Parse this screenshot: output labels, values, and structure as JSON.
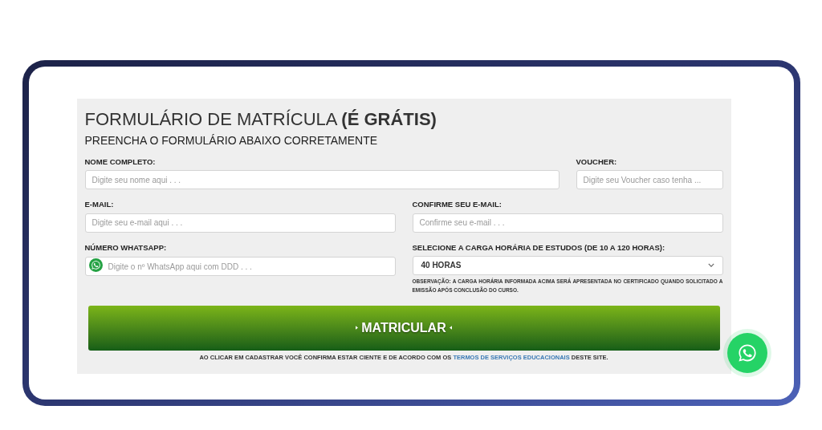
{
  "form": {
    "title": "FORMULÁRIO DE MATRÍCULA **(É GRÁTIS)**",
    "subtitle": "PREENCHA O FORMULÁRIO ABAIXO CORRETAMENTE",
    "fields": [
      {
        "kind": "text",
        "label": "NOME COMPLETO:",
        "placeholder": "Digite seu nome aqui . . ."
      },
      {
        "kind": "text",
        "label": "VOUCHER:",
        "placeholder": "Digite seu Voucher caso tenha ..."
      },
      {
        "kind": "text",
        "label": "E-MAIL:",
        "placeholder": "Digite seu e-mail aqui . . ."
      },
      {
        "kind": "text",
        "label": "CONFIRME SEU E-MAIL:",
        "placeholder": "Confirme seu e-mail . . ."
      },
      {
        "kind": "phone",
        "label": "NÚMERO WHATSAPP:",
        "placeholder": "Digite o nº WhatsApp aqui com DDD . . ."
      },
      {
        "kind": "select",
        "label": "SELECIONE A CARGA HORÁRIA DE ESTUDOS (DE 10 A 120 HORAS):",
        "value": "40 HORAS",
        "note": "OBSERVAÇÃO: A CARGA HORÁRIA INFORMADA ACIMA SERÁ APRESENTADA NO CERTIFICADO QUANDO SOLICITADO A EMISSÃO APÓS CONCLUSÃO DO CURSO."
      }
    ],
    "submit": "MATRICULAR",
    "terms": {
      "before": "AO CLICAR EM CADASTRAR VOCÊ CONFIRMA ESTAR CIENTE E DE ACORDO COM OS",
      "link": "TERMOS DE SERVIÇOS EDUCACIONAIS",
      "after": "DESTE SITE."
    }
  }
}
